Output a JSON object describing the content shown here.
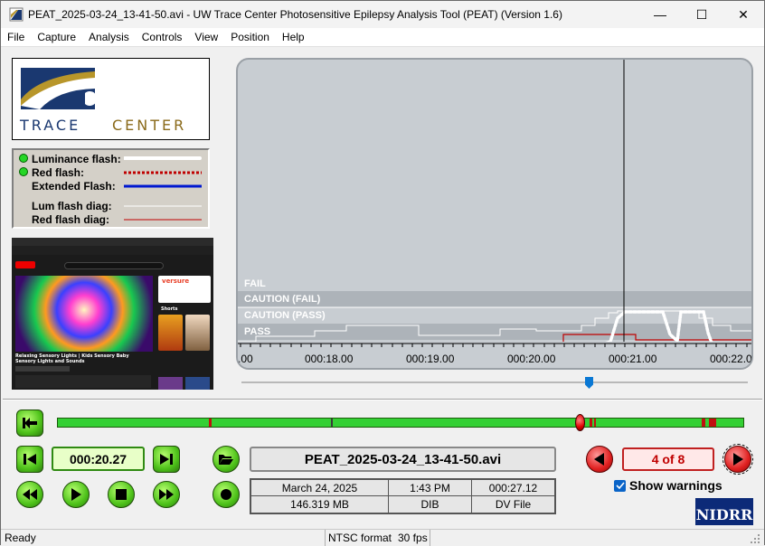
{
  "window": {
    "title": "PEAT_2025-03-24_13-41-50.avi - UW Trace Center Photosensitive Epilepsy Analysis Tool (PEAT) (Version 1.6)",
    "minimize": "—",
    "maximize": "☐",
    "close": "✕"
  },
  "menu": [
    "File",
    "Capture",
    "Analysis",
    "Controls",
    "View",
    "Position",
    "Help"
  ],
  "logo": {
    "text": "TRACE CENTER"
  },
  "legend": {
    "items": [
      {
        "label": "Luminance flash:"
      },
      {
        "label": "Red flash:"
      },
      {
        "label": "Extended Flash:"
      },
      {
        "label": "Lum flash diag:"
      },
      {
        "label": "Red flash diag:"
      }
    ]
  },
  "thumbnail": {
    "channel_title": "Relaxing Sensory Lights | Kids Sensory Baby Sensory Lights and Sounds",
    "ad": "versure",
    "shorts_label": "Shorts"
  },
  "graph": {
    "zones": [
      "FAIL",
      "CAUTION (FAIL)",
      "CAUTION (PASS)",
      "PASS"
    ],
    "time_ticks": [
      ".00",
      "000:18.00",
      "000:19.00",
      "000:20.00",
      "000:21.00",
      "000:22.0"
    ]
  },
  "controls": {
    "current_time": "000:20.27",
    "file_name": "PEAT_2025-03-24_13-41-50.avi",
    "date": "March 24, 2025",
    "time": "1:43 PM",
    "duration": "000:27.12",
    "size": "146.319 MB",
    "codec": "DIB",
    "source": "DV File",
    "warning_index": "4 of 8",
    "show_warnings_label": "Show warnings",
    "show_warnings_checked": true,
    "nidrr": "NIDRR"
  },
  "status": {
    "ready": "Ready",
    "format": "NTSC format",
    "fps": "30 fps"
  },
  "colors": {
    "pass_green": "#4ec21a",
    "warn_red": "#e02020",
    "graph_bg": "#c8cdd2",
    "caution_band": "#adb3b9"
  }
}
